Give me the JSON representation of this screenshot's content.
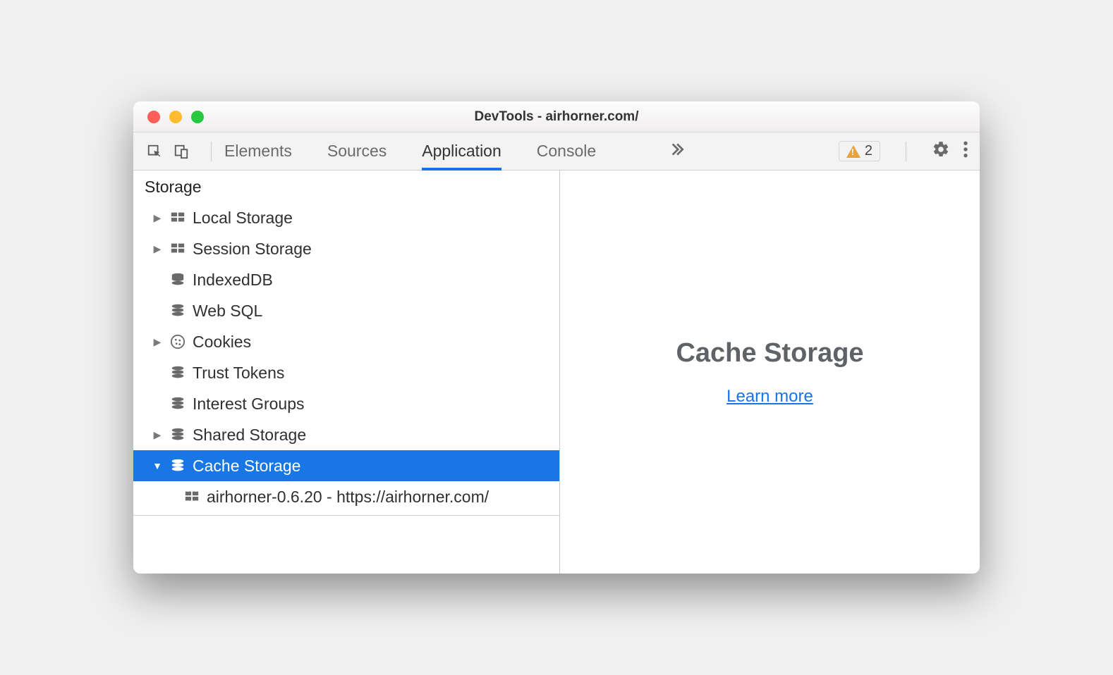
{
  "window": {
    "title": "DevTools - airhorner.com/"
  },
  "toolbar": {
    "tabs": [
      {
        "label": "Elements",
        "active": false
      },
      {
        "label": "Sources",
        "active": false
      },
      {
        "label": "Application",
        "active": true
      },
      {
        "label": "Console",
        "active": false
      }
    ],
    "warnings": "2"
  },
  "sidebar": {
    "section": "Storage",
    "items": [
      {
        "label": "Local Storage",
        "icon": "grid",
        "arrow": "right",
        "level": 1
      },
      {
        "label": "Session Storage",
        "icon": "grid",
        "arrow": "right",
        "level": 1
      },
      {
        "label": "IndexedDB",
        "icon": "db",
        "arrow": "none",
        "level": 1
      },
      {
        "label": "Web SQL",
        "icon": "db",
        "arrow": "none",
        "level": 1
      },
      {
        "label": "Cookies",
        "icon": "cookie",
        "arrow": "right",
        "level": 1
      },
      {
        "label": "Trust Tokens",
        "icon": "db",
        "arrow": "none",
        "level": 1
      },
      {
        "label": "Interest Groups",
        "icon": "db",
        "arrow": "none",
        "level": 1
      },
      {
        "label": "Shared Storage",
        "icon": "db",
        "arrow": "right",
        "level": 1
      },
      {
        "label": "Cache Storage",
        "icon": "db",
        "arrow": "down",
        "level": 1,
        "selected": true
      },
      {
        "label": "airhorner-0.6.20 - https://airhorner.com/",
        "icon": "grid",
        "arrow": "none",
        "level": 2
      }
    ]
  },
  "main": {
    "title": "Cache Storage",
    "link": "Learn more"
  }
}
